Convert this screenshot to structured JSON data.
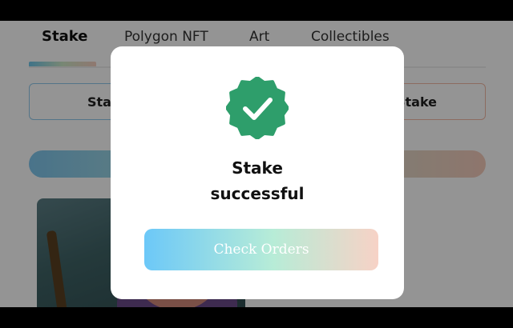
{
  "tabs": [
    {
      "label": "Stake",
      "active": true
    },
    {
      "label": "Polygon NFT",
      "active": false
    },
    {
      "label": "Art",
      "active": false
    },
    {
      "label": "Collectibles",
      "active": false
    }
  ],
  "actions": {
    "left_stake_label": "Stake",
    "right_stake_label": "Stake"
  },
  "dialog": {
    "icon": "verified-check-icon",
    "title": "Stake successful",
    "button_label": "Check Orders"
  },
  "colors": {
    "badge_green": "#2e9e6b",
    "accent_blue": "#6cc8f8",
    "accent_peach": "#f7d2c6"
  }
}
